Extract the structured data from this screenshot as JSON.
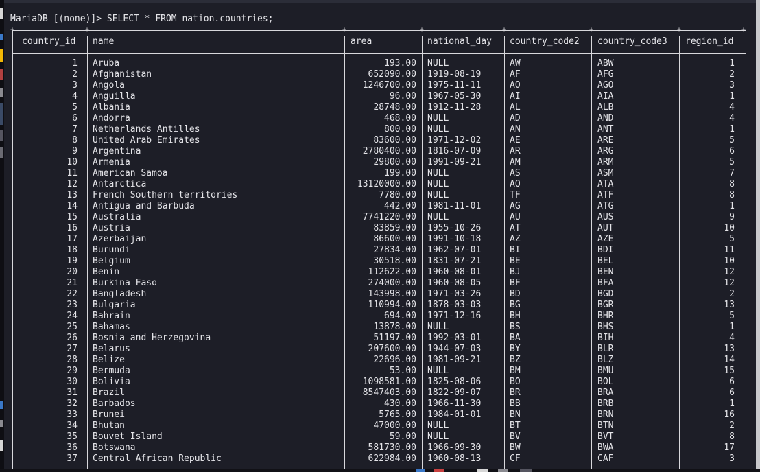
{
  "terminal": {
    "prompt": "MariaDB [(none)]>",
    "command": "SELECT * FROM nation.countries;"
  },
  "table": {
    "columns": [
      "country_id",
      "name",
      "area",
      "national_day",
      "country_code2",
      "country_code3",
      "region_id"
    ],
    "rows": [
      [
        "1",
        "Aruba",
        "193.00",
        "NULL",
        "AW",
        "ABW",
        "1"
      ],
      [
        "2",
        "Afghanistan",
        "652090.00",
        "1919-08-19",
        "AF",
        "AFG",
        "2"
      ],
      [
        "3",
        "Angola",
        "1246700.00",
        "1975-11-11",
        "AO",
        "AGO",
        "3"
      ],
      [
        "4",
        "Anguilla",
        "96.00",
        "1967-05-30",
        "AI",
        "AIA",
        "1"
      ],
      [
        "5",
        "Albania",
        "28748.00",
        "1912-11-28",
        "AL",
        "ALB",
        "4"
      ],
      [
        "6",
        "Andorra",
        "468.00",
        "NULL",
        "AD",
        "AND",
        "4"
      ],
      [
        "7",
        "Netherlands Antilles",
        "800.00",
        "NULL",
        "AN",
        "ANT",
        "1"
      ],
      [
        "8",
        "United Arab Emirates",
        "83600.00",
        "1971-12-02",
        "AE",
        "ARE",
        "5"
      ],
      [
        "9",
        "Argentina",
        "2780400.00",
        "1816-07-09",
        "AR",
        "ARG",
        "6"
      ],
      [
        "10",
        "Armenia",
        "29800.00",
        "1991-09-21",
        "AM",
        "ARM",
        "5"
      ],
      [
        "11",
        "American Samoa",
        "199.00",
        "NULL",
        "AS",
        "ASM",
        "7"
      ],
      [
        "12",
        "Antarctica",
        "13120000.00",
        "NULL",
        "AQ",
        "ATA",
        "8"
      ],
      [
        "13",
        "French Southern territories",
        "7780.00",
        "NULL",
        "TF",
        "ATF",
        "8"
      ],
      [
        "14",
        "Antigua and Barbuda",
        "442.00",
        "1981-11-01",
        "AG",
        "ATG",
        "1"
      ],
      [
        "15",
        "Australia",
        "7741220.00",
        "NULL",
        "AU",
        "AUS",
        "9"
      ],
      [
        "16",
        "Austria",
        "83859.00",
        "1955-10-26",
        "AT",
        "AUT",
        "10"
      ],
      [
        "17",
        "Azerbaijan",
        "86600.00",
        "1991-10-18",
        "AZ",
        "AZE",
        "5"
      ],
      [
        "18",
        "Burundi",
        "27834.00",
        "1962-07-01",
        "BI",
        "BDI",
        "11"
      ],
      [
        "19",
        "Belgium",
        "30518.00",
        "1831-07-21",
        "BE",
        "BEL",
        "10"
      ],
      [
        "20",
        "Benin",
        "112622.00",
        "1960-08-01",
        "BJ",
        "BEN",
        "12"
      ],
      [
        "21",
        "Burkina Faso",
        "274000.00",
        "1960-08-05",
        "BF",
        "BFA",
        "12"
      ],
      [
        "22",
        "Bangladesh",
        "143998.00",
        "1971-03-26",
        "BD",
        "BGD",
        "2"
      ],
      [
        "23",
        "Bulgaria",
        "110994.00",
        "1878-03-03",
        "BG",
        "BGR",
        "13"
      ],
      [
        "24",
        "Bahrain",
        "694.00",
        "1971-12-16",
        "BH",
        "BHR",
        "5"
      ],
      [
        "25",
        "Bahamas",
        "13878.00",
        "NULL",
        "BS",
        "BHS",
        "1"
      ],
      [
        "26",
        "Bosnia and Herzegovina",
        "51197.00",
        "1992-03-01",
        "BA",
        "BIH",
        "4"
      ],
      [
        "27",
        "Belarus",
        "207600.00",
        "1944-07-03",
        "BY",
        "BLR",
        "13"
      ],
      [
        "28",
        "Belize",
        "22696.00",
        "1981-09-21",
        "BZ",
        "BLZ",
        "14"
      ],
      [
        "29",
        "Bermuda",
        "53.00",
        "NULL",
        "BM",
        "BMU",
        "15"
      ],
      [
        "30",
        "Bolivia",
        "1098581.00",
        "1825-08-06",
        "BO",
        "BOL",
        "6"
      ],
      [
        "31",
        "Brazil",
        "8547403.00",
        "1822-09-07",
        "BR",
        "BRA",
        "6"
      ],
      [
        "32",
        "Barbados",
        "430.00",
        "1966-11-30",
        "BB",
        "BRB",
        "1"
      ],
      [
        "33",
        "Brunei",
        "5765.00",
        "1984-01-01",
        "BN",
        "BRN",
        "16"
      ],
      [
        "34",
        "Bhutan",
        "47000.00",
        "NULL",
        "BT",
        "BTN",
        "2"
      ],
      [
        "35",
        "Bouvet Island",
        "59.00",
        "NULL",
        "BV",
        "BVT",
        "8"
      ],
      [
        "36",
        "Botswana",
        "581730.00",
        "1966-09-30",
        "BW",
        "BWA",
        "17"
      ],
      [
        "37",
        "Central African Republic",
        "622984.00",
        "1960-08-13",
        "CF",
        "CAF",
        "3"
      ]
    ]
  },
  "colors": {
    "terminal_bg": "#1d1e27",
    "text": "#e4e4e8",
    "border": "#d8d8dc",
    "left_strip_accent": "#f2b705",
    "left_strip_blue": "#3a78c8"
  }
}
